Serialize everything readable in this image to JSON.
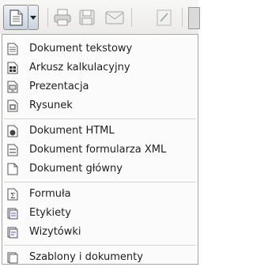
{
  "toolbar": {
    "buttons": [
      {
        "name": "new-document-button",
        "icon": "document-icon"
      },
      {
        "name": "new-dropdown-arrow",
        "icon": "chevron-down-icon"
      },
      {
        "name": "print-button",
        "icon": "printer-icon"
      },
      {
        "name": "save-button",
        "icon": "floppy-icon"
      },
      {
        "name": "send-button",
        "icon": "envelope-icon"
      },
      {
        "name": "edit-button",
        "icon": "pencil-icon"
      }
    ]
  },
  "menu": {
    "groups": [
      [
        {
          "label": "Dokument tekstowy",
          "icon": "text-document-icon"
        },
        {
          "label": "Arkusz kalkulacyjny",
          "icon": "spreadsheet-icon"
        },
        {
          "label": "Prezentacja",
          "icon": "presentation-icon"
        },
        {
          "label": "Rysunek",
          "icon": "drawing-icon"
        }
      ],
      [
        {
          "label": "Dokument HTML",
          "icon": "html-document-icon"
        },
        {
          "label": "Dokument formularza XML",
          "icon": "xml-form-icon"
        },
        {
          "label": "Dokument główny",
          "icon": "master-document-icon"
        }
      ],
      [
        {
          "label": "Formuła",
          "icon": "formula-icon"
        },
        {
          "label": "Etykiety",
          "icon": "labels-icon"
        },
        {
          "label": "Wizytówki",
          "icon": "business-cards-icon"
        }
      ],
      [
        {
          "label": "Szablony i dokumenty",
          "icon": "templates-icon"
        }
      ]
    ]
  }
}
